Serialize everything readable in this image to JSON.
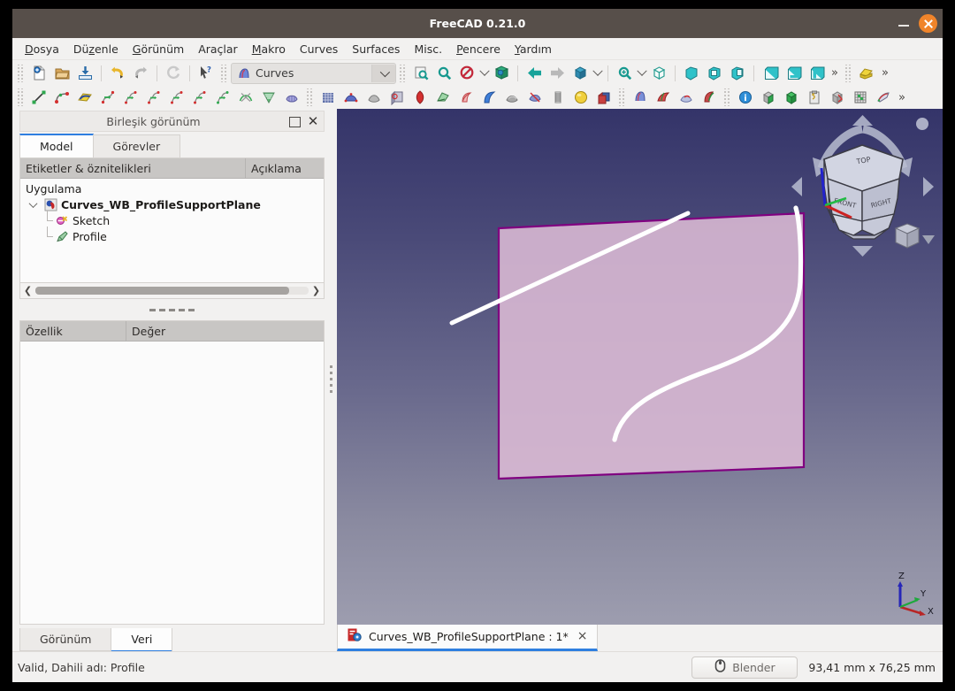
{
  "window": {
    "title": "FreeCAD 0.21.0",
    "minimize_label": "minimize",
    "close_label": "close"
  },
  "menubar": {
    "items": [
      {
        "label": "Dosya",
        "accel": "D"
      },
      {
        "label": "Düzenle",
        "accel": "z"
      },
      {
        "label": "Görünüm",
        "accel": "G"
      },
      {
        "label": "Araçlar",
        "accel": ""
      },
      {
        "label": "Makro",
        "accel": "M"
      },
      {
        "label": "Curves",
        "accel": ""
      },
      {
        "label": "Surfaces",
        "accel": ""
      },
      {
        "label": "Misc.",
        "accel": ""
      },
      {
        "label": "Pencere",
        "accel": "P"
      },
      {
        "label": "Yardım",
        "accel": "Y"
      }
    ]
  },
  "toolbar": {
    "workbench_label": "Curves",
    "workbench_icon": "curves-workbench-icon",
    "overflow_label": "»",
    "row1_icons": [
      "new-document-icon",
      "open-document-icon",
      "save-document-icon",
      "undo-icon",
      "redo-icon",
      "refresh-icon",
      "whats-this-icon"
    ],
    "row1_view_icons": [
      "fit-all-icon",
      "zoom-fit-selection-icon",
      "draw-style-icon",
      "axonometric-icon",
      "back-view-icon",
      "forward-view-icon",
      "std-views-icon",
      "zoom-in-icon",
      "isometric-icon",
      "front-view-icon",
      "top-view-icon",
      "right-view-icon",
      "rear-view-icon",
      "bottom-view-icon",
      "left-view-icon"
    ],
    "row2_icons": [
      "line-icon",
      "bezier-curve-icon",
      "editable-spline-icon",
      "interpolation-curve-icon",
      "approximate-curve-icon",
      "parametric-blend-icon",
      "discretize-icon",
      "join-curve-icon",
      "split-curve-icon",
      "curve-extend-icon",
      "curve-on-surface-icon",
      "isocurves-icon",
      "gordon-surface-icon",
      "surface-blend-icon",
      "ruled-surface-icon",
      "flatten-face-icon",
      "segment-surface-icon",
      "sublink-icon",
      "pipeshell-icon",
      "sweep2rails-icon",
      "profile-support-icon",
      "hooks-icon",
      "zebra-stripes-icon",
      "sphere-icon",
      "solid-from-shell-icon",
      "profile-icon",
      "paramvector-icon",
      "mixed-curve-icon",
      "reflect-lines-icon",
      "info-icon",
      "box-element-icon",
      "solid-icon",
      "script-icon",
      "trim-face-icon",
      "grid-icon",
      "sketch-on-surface-icon"
    ]
  },
  "left_panel": {
    "header_title": "Birleşik görünüm",
    "float_icon": "restore-icon",
    "close_icon": "close-icon",
    "tabs": [
      {
        "label": "Model",
        "active": true
      },
      {
        "label": "Görevler",
        "active": false
      }
    ],
    "tree": {
      "columns": [
        "Etiketler & öznitelikleri",
        "Açıklama"
      ],
      "root_label": "Uygulama",
      "nodes": [
        {
          "label": "Curves_WB_ProfileSupportPlane",
          "icon": "document-icon",
          "bold": true,
          "depth": 1
        },
        {
          "label": "Sketch",
          "icon": "sketch-icon",
          "bold": false,
          "depth": 2
        },
        {
          "label": "Profile",
          "icon": "profile-icon",
          "bold": false,
          "depth": 2
        }
      ]
    },
    "properties": {
      "columns": [
        "Özellik",
        "Değer"
      ],
      "rows": []
    },
    "bottom_tabs": [
      {
        "label": "Görünüm",
        "active": false
      },
      {
        "label": "Veri",
        "active": true
      }
    ]
  },
  "viewport": {
    "document_tab": {
      "label": "Curves_WB_ProfileSupportPlane  : 1*",
      "icon": "freecad-document-icon",
      "close_label": "×"
    },
    "nav_cube_labels": [
      "TOP",
      "FRONT",
      "RIGHT"
    ],
    "axis_labels": {
      "x": "X",
      "y": "Y",
      "z": "Z"
    },
    "colors": {
      "bg_top": "#343469",
      "bg_bottom": "#9d9daf",
      "face_fill": "#dcbbd5",
      "face_edge": "#800080",
      "curve": "#ffffff"
    }
  },
  "statusbar": {
    "message": "Valid, Dahili adı: Profile",
    "nav_style": "Blender",
    "nav_icon": "mouse-icon",
    "dimensions": "93,41 mm x 76,25 mm"
  }
}
